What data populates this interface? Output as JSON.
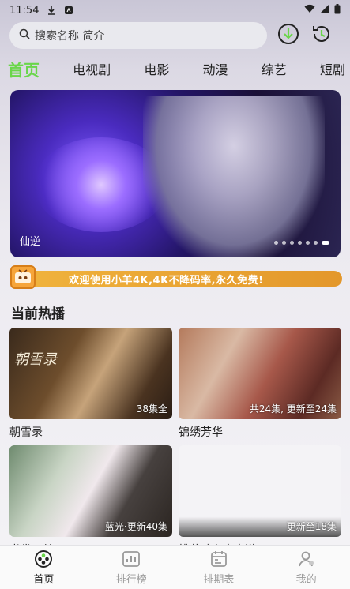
{
  "status": {
    "time": "11:54"
  },
  "search": {
    "placeholder": "搜索名称 简介"
  },
  "tabs": [
    "首页",
    "电视剧",
    "电影",
    "动漫",
    "综艺",
    "短剧"
  ],
  "banner": {
    "title": "仙逆",
    "slide_count": 7,
    "active_index": 6
  },
  "notice": {
    "text": "欢迎使用小羊4K,4K不降码率,永久免费!"
  },
  "section": {
    "title": "当前热播"
  },
  "cards": [
    {
      "title": "朝雪录",
      "badge": "38集全",
      "art_title": "朝雪录"
    },
    {
      "title": "锦绣芳华",
      "badge": "共24集, 更新至24集"
    },
    {
      "title": "书卷一梦",
      "badge": "蓝光·更新40集"
    },
    {
      "title": "桃花映在水中道",
      "badge": "更新至18集"
    }
  ],
  "bottom_nav": [
    {
      "label": "首页",
      "icon": "home-icon",
      "active": true
    },
    {
      "label": "排行榜",
      "icon": "ranking-icon",
      "active": false
    },
    {
      "label": "排期表",
      "icon": "schedule-icon",
      "active": false
    },
    {
      "label": "我的",
      "icon": "profile-icon",
      "active": false
    }
  ],
  "colors": {
    "accent": "#6ad64a",
    "notice": "#e8a132"
  }
}
